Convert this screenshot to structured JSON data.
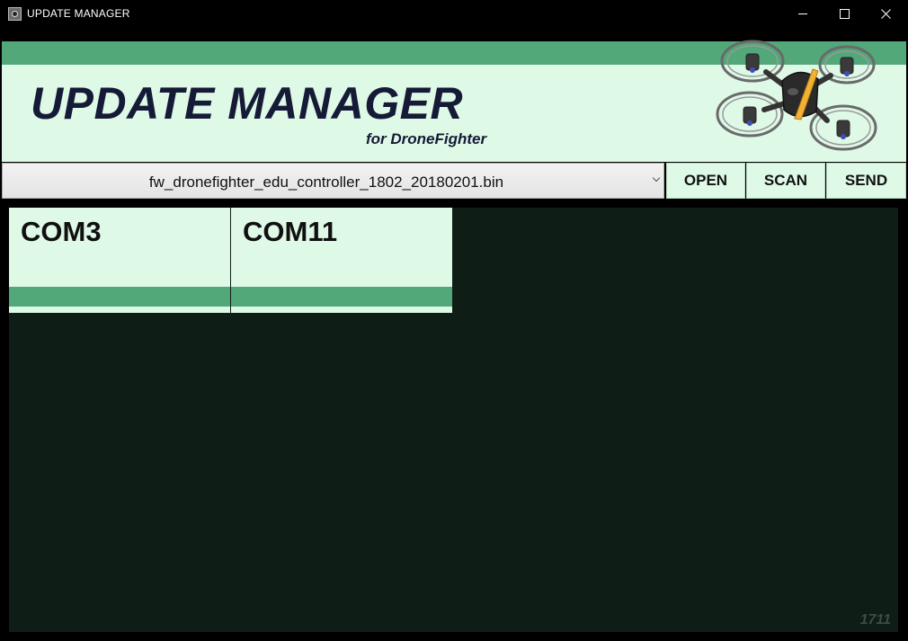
{
  "window": {
    "title": "UPDATE MANAGER",
    "icon": "drone-app-icon",
    "controls": [
      "minimize-icon",
      "maximize-icon",
      "close-icon"
    ]
  },
  "header": {
    "title": "UPDATE MANAGER",
    "subtitle": "for DroneFighter",
    "image": "drone-image"
  },
  "toolbar": {
    "selected_file": "fw_dronefighter_edu_controller_1802_20180201.bin",
    "open_label": "OPEN",
    "scan_label": "SCAN",
    "send_label": "SEND"
  },
  "ports": [
    {
      "name": "COM3",
      "progress": 0
    },
    {
      "name": "COM11",
      "progress": 0
    }
  ],
  "footer": {
    "build": "1711"
  },
  "colors": {
    "accent_green": "#52a878",
    "light_green": "#dff9e7",
    "dark_panel": "#0e1e17",
    "title_navy": "#151a36"
  }
}
